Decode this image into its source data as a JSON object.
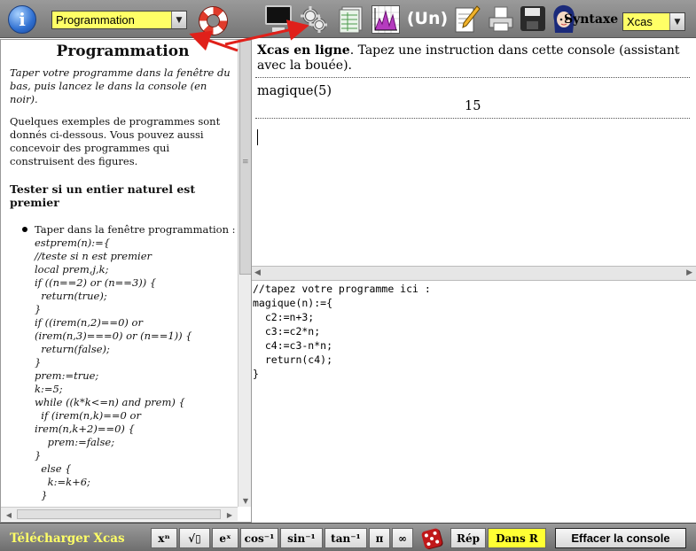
{
  "toolbar": {
    "info_label": "i",
    "mode_select_value": "Programmation",
    "sequence_label": "(Un)",
    "syntax_label": "Syntaxe",
    "syntax_select_value": "Xcas",
    "icons": [
      "info-icon",
      "lifebuoy-icon",
      "console-icon",
      "gears-icon",
      "spreadsheet-icon",
      "graph-icon",
      "sequence-icon",
      "edit-icon",
      "print-icon",
      "save-icon",
      "avatar"
    ]
  },
  "help": {
    "title": "Programmation",
    "intro": "Taper votre programme dans la fenêtre du bas, puis lancez le dans la console (en noir).",
    "examples": "Quelques exemples de programmes sont donnés ci-dessous. Vous pouvez aussi concevoir des programmes qui construisent des figures.",
    "section_title": "Tester si un entier naturel est premier",
    "list_item": "Taper dans la fenêtre programmation :",
    "code": [
      "estprem(n):={",
      "//teste si n est premier",
      "local prem,j,k;",
      "if ((n==2) or (n==3)) {",
      "  return(true);",
      "}",
      "if ((irem(n,2)==0) or",
      "(irem(n,3)===0) or (n==1)) {",
      "  return(false);",
      "}",
      "prem:=true;",
      "k:=5;",
      "while ((k*k<=n) and prem) {",
      "  if (irem(n,k)==0 or",
      "irem(n,k+2)==0) {",
      "    prem:=false;",
      "}",
      "  else {",
      "    k:=k+6;",
      "  }"
    ]
  },
  "console": {
    "header_bold": "Xcas en ligne",
    "header_rest": ". Tapez une instruction dans cette console (assistant avec la bouée).",
    "command": "magique(5)",
    "result": "15"
  },
  "editor": {
    "lines": [
      "//tapez votre programme ici :",
      "magique(n):={",
      "  c2:=n+3;",
      "  c3:=c2*n;",
      "  c4:=c3-n*n;",
      "  return(c4);",
      "}"
    ]
  },
  "bottom": {
    "download_label": "Télécharger Xcas",
    "keys": [
      "xⁿ",
      "√▯",
      "eˣ",
      "cos⁻¹",
      "sin⁻¹",
      "tan⁻¹",
      "π",
      "∞"
    ],
    "rep_label": "Rép",
    "dansR_label": "Dans R",
    "clear_label": "Effacer la console"
  },
  "colors": {
    "toolbar_bg": "#8a8a8a",
    "select_yellow": "#ffff66",
    "accent_yellow": "#ffff33",
    "arrow_red": "#e0201a"
  }
}
